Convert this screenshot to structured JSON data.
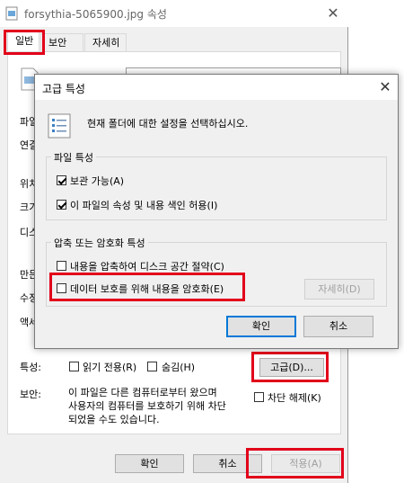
{
  "back_window": {
    "title": "forsythia-5065900.jpg 속성",
    "close_glyph": "✕",
    "tabs": [
      {
        "label": "일반"
      },
      {
        "label": "보안"
      },
      {
        "label": "자세히"
      }
    ],
    "side_labels": [
      "파일",
      "연결",
      "위치",
      "크기",
      "디스",
      "만든",
      "수정",
      "액세"
    ],
    "attributes_label": "특성:",
    "readonly_label": "읽기 전용(R)",
    "hidden_label": "숨김(H)",
    "advanced_button": "고급(D)...",
    "security_label": "보안:",
    "security_text_1": "이 파일은 다른 컴퓨터로부터 왔으며",
    "security_text_2": "사용자의 컴퓨터를 보호하기 위해 차단",
    "security_text_3": "되었을 수도 있습니다.",
    "unblock_label": "차단 해제(K)",
    "ok_button": "확인",
    "cancel_button": "취소",
    "apply_button": "적용(A)"
  },
  "dialog": {
    "title": "고급 특성",
    "close_glyph": "✕",
    "description": "현재 폴더에 대한 설정을 선택하십시오.",
    "file_attributes_group": {
      "title": "파일 특성",
      "archive_label": "보관 가능(A)",
      "archive_checked": true,
      "index_label": "이 파일의 속성 및 내용 색인 허용(I)",
      "index_checked": true
    },
    "compress_group": {
      "title": "압축 또는 암호화 특성",
      "compress_label": "내용을 압축하여 디스크 공간 절약(C)",
      "compress_checked": false,
      "encrypt_label": "데이터 보호를 위해 내용을 암호화(E)",
      "encrypt_checked": false,
      "details_button": "자세히(D)"
    },
    "ok_button": "확인",
    "cancel_button": "취소"
  },
  "colors": {
    "highlight": "#e2001a",
    "focus": "#0078d7"
  }
}
